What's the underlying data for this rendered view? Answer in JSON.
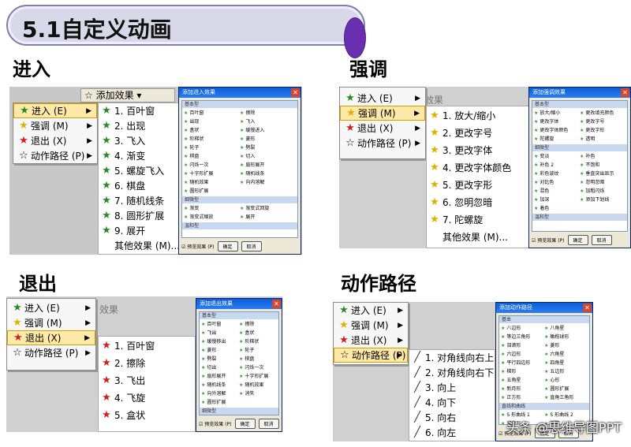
{
  "title": "5.1自定义动画",
  "sections": {
    "enter": "进入",
    "emph": "强调",
    "exit": "退出",
    "path": "动作路径"
  },
  "main_menu": {
    "enter": "进入 (E)",
    "emph": "强调 (M)",
    "exit": "退出 (X)",
    "path": "动作路径 (P)"
  },
  "toolbar_add": "添加效果",
  "enter_items": [
    "1. 百叶窗",
    "2. 出现",
    "3. 飞入",
    "4. 渐变",
    "5. 螺旋飞入",
    "6. 棋盘",
    "7. 随机线条",
    "8. 圆形扩展",
    "9. 展开"
  ],
  "enter_more": "其他效果 (M)...",
  "emph_items": [
    "1. 放大/缩小",
    "2. 更改字号",
    "3. 更改字体",
    "4. 更改字体颜色",
    "5. 更改字形",
    "6. 忽明忽暗",
    "7. 陀螺旋"
  ],
  "emph_more": "其他效果 (M)...",
  "exit_items": [
    "1. 百叶窗",
    "2. 擦除",
    "3. 飞出",
    "4. 飞旋",
    "5. 盒状"
  ],
  "path_items": [
    "1. 对角线向右上",
    "2. 对角线向右下",
    "3. 向上",
    "4. 向下",
    "5. 向右",
    "6. 向左"
  ],
  "effect_label": "效果",
  "dlg_enter": {
    "title": "添加进入效果",
    "group1": "基本型",
    "items": [
      "百叶窗",
      "擦除",
      "出现",
      "飞入",
      "盒状",
      "缓慢进入",
      "阶梯状",
      "菱形",
      "轮子",
      "劈裂",
      "棋盘",
      "切入",
      "闪烁一次",
      "扇形展开",
      "十字形扩展",
      "随机线条",
      "随机效果",
      "向内溶解",
      "圆形扩展"
    ],
    "group2": "细微型",
    "items2": [
      "渐变",
      "渐变式回旋",
      "渐变式缩放",
      "展开"
    ],
    "group3": "温和型",
    "preview": "预览效果 (P)",
    "ok": "确定",
    "cancel": "取消"
  },
  "dlg_emph": {
    "title": "添加强调效果",
    "group1": "基本型",
    "items": [
      "放大/缩小",
      "更改填充颜色",
      "更改字体",
      "更改字号",
      "更改字体颜色",
      "更改字形",
      "陀螺旋",
      "透明"
    ],
    "group2": "细微型",
    "items2": [
      "变淡",
      "补色",
      "补色 2",
      "不饱和",
      "彩色波纹",
      "垂直突出显示",
      "对比色",
      "忽明忽暗",
      "混色",
      "加粗闪烁",
      "加深",
      "添加下划线",
      "着色"
    ],
    "group3": "温和型",
    "preview": "预览效果 (P)",
    "ok": "确定",
    "cancel": "取消"
  },
  "dlg_exit": {
    "title": "添加退出效果",
    "group1": "基本型",
    "items": [
      "百叶窗",
      "擦除",
      "飞出",
      "盒状",
      "缓慢移出",
      "阶梯状",
      "菱形",
      "轮子",
      "劈裂",
      "棋盘",
      "切出",
      "闪烁一次",
      "扇形展开",
      "十字形扩展",
      "随机线条",
      "随机效果",
      "向外溶解",
      "消失",
      "圆形扩展"
    ],
    "group2": "细微型",
    "items2": [
      "渐变",
      "渐变式回旋",
      "渐变式缩放",
      "收缩"
    ],
    "group3": "温和型",
    "preview": "预览效果 (P)",
    "ok": "确定",
    "cancel": "取消"
  },
  "dlg_path": {
    "title": "添加动作路径",
    "group1": "基本",
    "items": [
      "八边形",
      "八角星",
      "等边三角形",
      "橄榄球形",
      "泪滴形",
      "菱形",
      "六边形",
      "六角星",
      "平行四边形",
      "四角星",
      "梯形",
      "五边形",
      "五角星",
      "心形",
      "新月形",
      "圆形扩展",
      "正方形",
      "直角三角形"
    ],
    "group2": "直线和曲线",
    "items2": [
      "S 形曲线 1",
      "S 形曲线 2",
      "波浪形",
      "弹簧"
    ],
    "preview": "预览效果 (P)",
    "ok": "确定",
    "cancel": "取消"
  },
  "footer": "头条 @思维导图PPT"
}
